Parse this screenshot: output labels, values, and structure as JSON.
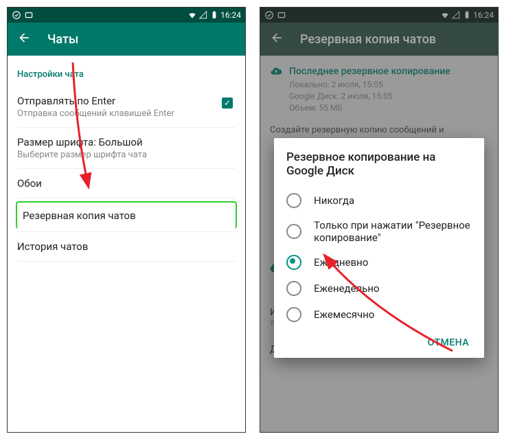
{
  "statusbar": {
    "time": "16:24"
  },
  "left": {
    "title": "Чаты",
    "section": "Настройки чата",
    "rows": {
      "enter": {
        "title": "Отправлять по Enter",
        "sub": "Отправка сообщений клавишей Enter"
      },
      "font": {
        "title": "Размер шрифта: Большой",
        "sub": "Выберите размер шрифта чата"
      },
      "wallpaper": {
        "title": "Обои"
      },
      "backup": {
        "title": "Резервная копия чатов"
      },
      "history": {
        "title": "История чатов"
      }
    }
  },
  "right": {
    "title": "Резервная копия чатов",
    "last_backup": {
      "header": "Последнее резервное копирование",
      "local": "Локально: 2 июля, 15:05",
      "gdrive": "Google Диск: 2 июля, 15:05",
      "size": "Объем: 55 МБ",
      "hint": "Создайте резервную копию сообщений и"
    },
    "dialog": {
      "title": "Резервное копирование на Google Диск",
      "options": {
        "never": "Никогда",
        "manual": "Только при нажатии \"Резервное копирование\"",
        "daily": "Ежедневно",
        "weekly": "Еженедельно",
        "monthly": "Ежемесячно"
      },
      "cancel": "ОТМЕНА"
    },
    "below": {
      "network_title": "Использовать",
      "network_sub": "только Wi-Fi",
      "video": "Добавить видео"
    }
  }
}
